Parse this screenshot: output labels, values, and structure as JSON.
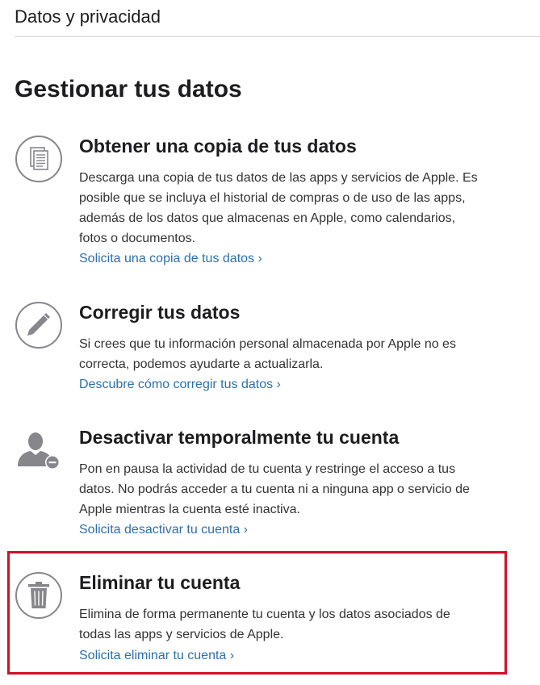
{
  "header": {
    "title": "Datos y privacidad"
  },
  "main": {
    "heading": "Gestionar tus datos",
    "sections": [
      {
        "icon": "document-copy-icon",
        "title": "Obtener una copia de tus datos",
        "description": [
          "Descarga una copia de tus datos de las apps y servicios de Apple. Es",
          "posible que se incluya el historial de compras o de uso de las apps,",
          "además de los datos que almacenas en Apple, como calendarios,",
          "fotos o documentos."
        ],
        "link": "Solicita una copia de tus datos ›"
      },
      {
        "icon": "pencil-icon",
        "title": "Corregir tus datos",
        "description": [
          "Si crees que tu información personal almacenada por Apple no es",
          "correcta, podemos ayudarte a actualizarla."
        ],
        "link": "Descubre cómo corregir tus datos ›"
      },
      {
        "icon": "user-deactivate-icon",
        "title": "Desactivar temporalmente tu cuenta",
        "description": [
          "Pon en pausa la actividad de tu cuenta y restringe el acceso a tus",
          "datos. No podrás acceder a tu cuenta ni a ninguna app o servicio de",
          "Apple mientras la cuenta esté inactiva."
        ],
        "link": "Solicita desactivar tu cuenta ›"
      },
      {
        "icon": "trash-icon",
        "title": "Eliminar tu cuenta",
        "description": [
          "Elimina de forma permanente tu cuenta y los datos asociados de",
          "todas las apps y servicios de Apple."
        ],
        "link": "Solicita eliminar tu cuenta ›"
      }
    ]
  },
  "colors": {
    "text": "#1d1d1f",
    "body_text": "#333333",
    "link": "#2f6fa8",
    "icon": "#86868b",
    "highlight": "#d0102a",
    "divider": "#d2d2d7"
  }
}
